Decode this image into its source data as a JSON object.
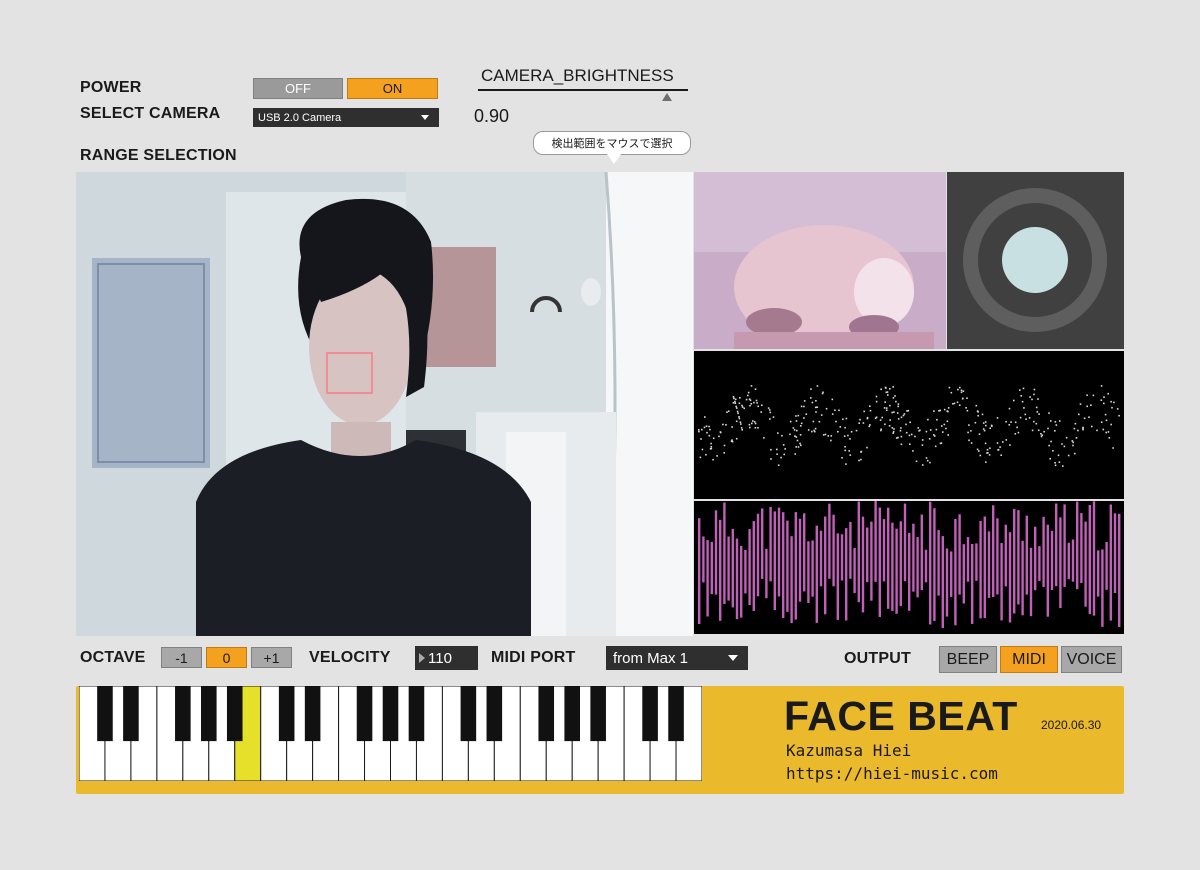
{
  "power": {
    "label": "POWER",
    "off": "OFF",
    "on": "ON",
    "selected": "ON"
  },
  "camera_select": {
    "label": "SELECT CAMERA",
    "value": "USB 2.0 Camera"
  },
  "brightness": {
    "label": "CAMERA_BRIGHTNESS",
    "value": "0.90",
    "level": 0.9
  },
  "tooltip": "検出範囲をマウスで選択",
  "range": {
    "label": "RANGE SELECTION"
  },
  "octave": {
    "label": "OCTAVE",
    "options": [
      "-1",
      "0",
      "+1"
    ],
    "selected": "0"
  },
  "velocity": {
    "label": "VELOCITY",
    "value": "110"
  },
  "midi_port": {
    "label": "MIDI PORT",
    "value": "from Max 1"
  },
  "output": {
    "label": "OUTPUT",
    "options": [
      "BEEP",
      "MIDI",
      "VOICE"
    ],
    "selected": "MIDI"
  },
  "footer": {
    "title": "FACE BEAT",
    "date": "2020.06.30",
    "author": "Kazumasa Hiei",
    "url": "https://hiei-music.com"
  },
  "keyboard": {
    "white_keys": 24,
    "highlighted_white_index": 6
  },
  "colors": {
    "accent": "#f4a11f",
    "footer_bg": "#ebb92c",
    "wave": "#c060b8",
    "highlight_key": "#e6e02a",
    "indicator": "#c8e0e2"
  }
}
